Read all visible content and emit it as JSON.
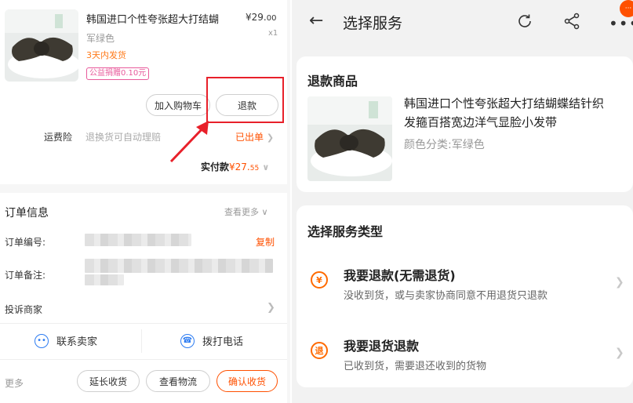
{
  "left": {
    "product": {
      "title": "韩国进口个性夸张超大打结蝴",
      "price_symbol": "¥",
      "price_int": "29.",
      "price_dec": "00",
      "color": "军绿色",
      "qty": "x1",
      "ship_time": "3天内发货",
      "charity": "公益捐赠0.10元"
    },
    "buttons": {
      "add_cart": "加入购物车",
      "refund": "退款"
    },
    "insurance": {
      "label": "运费险",
      "desc": "退换货可自动理赔",
      "status": "已出单"
    },
    "paid": {
      "label": "实付款",
      "symbol": "¥",
      "int": "27.",
      "dec": "55"
    },
    "order": {
      "title": "订单信息",
      "more": "查看更多",
      "number_label": "订单编号:",
      "copy": "复制",
      "note_label": "订单备注:",
      "complain": "投诉商家"
    },
    "contact": {
      "seller": "联系卖家",
      "phone": "拨打电话"
    },
    "footer": {
      "more": "更多",
      "extend": "延长收货",
      "logistics": "查看物流",
      "confirm": "确认收货"
    }
  },
  "right": {
    "header": {
      "title": "选择服务",
      "badge": "···"
    },
    "refund_item": {
      "section_title": "退款商品",
      "name": "韩国进口个性夸张超大打结蝴蝶结针织发箍百搭宽边洋气显脸小发带",
      "spec": "颜色分类:军绿色"
    },
    "service_type": {
      "section_title": "选择服务类型",
      "options": [
        {
          "title": "我要退款(无需退货)",
          "desc": "没收到货，或与卖家协商同意不用退货只退款",
          "icon_text": "¥"
        },
        {
          "title": "我要退货退款",
          "desc": "已收到货，需要退还收到的货物",
          "icon_text": "退"
        }
      ]
    }
  },
  "colors": {
    "accent": "#ff5000",
    "highlight": "#e8202a",
    "blue": "#2d7cf2"
  }
}
